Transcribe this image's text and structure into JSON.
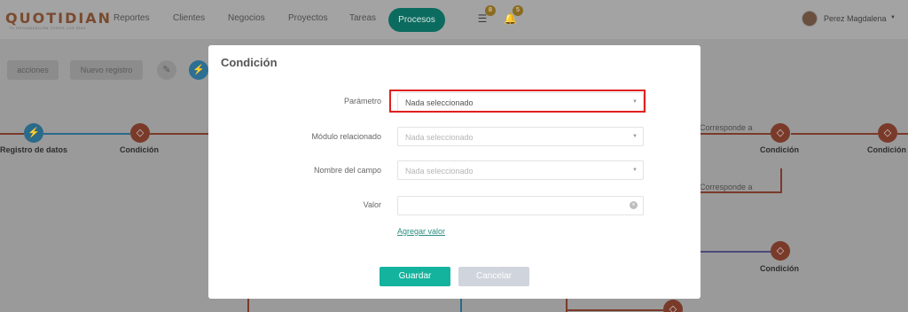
{
  "brand": {
    "logo": "QUOTIDIAN",
    "tagline": "TU ORGANIZACIÓN TODOS LOS DÍAS"
  },
  "nav": {
    "items": [
      "Reportes",
      "Clientes",
      "Negocios",
      "Proyectos",
      "Tareas"
    ],
    "active": "Procesos",
    "badges": {
      "tasks": "8",
      "notifications": "5"
    },
    "user": "Perez Magdalena"
  },
  "toolbar": {
    "actions": "acciones",
    "new_record": "Nuevo registro"
  },
  "flow": {
    "labels": {
      "data_record": "Registro de datos",
      "condition": "Condición",
      "corresponds_to": "Corresponde a"
    }
  },
  "modal": {
    "title": "Condición",
    "fields": {
      "parameter": {
        "label": "Parámetro",
        "value": "Nada seleccionado"
      },
      "related_module": {
        "label": "Módulo relacionado",
        "placeholder": "Nada seleccionado"
      },
      "field_name": {
        "label": "Nombre del campo",
        "placeholder": "Nada seleccionado"
      },
      "value": {
        "label": "Valor",
        "value": ""
      }
    },
    "add_value": "Agregar valor",
    "save": "Guardar",
    "cancel": "Cancelar"
  },
  "colors": {
    "accent": "#13b39e",
    "node_condition": "#e8643f",
    "node_data": "#3aa3d8",
    "highlight": "#e02020"
  }
}
